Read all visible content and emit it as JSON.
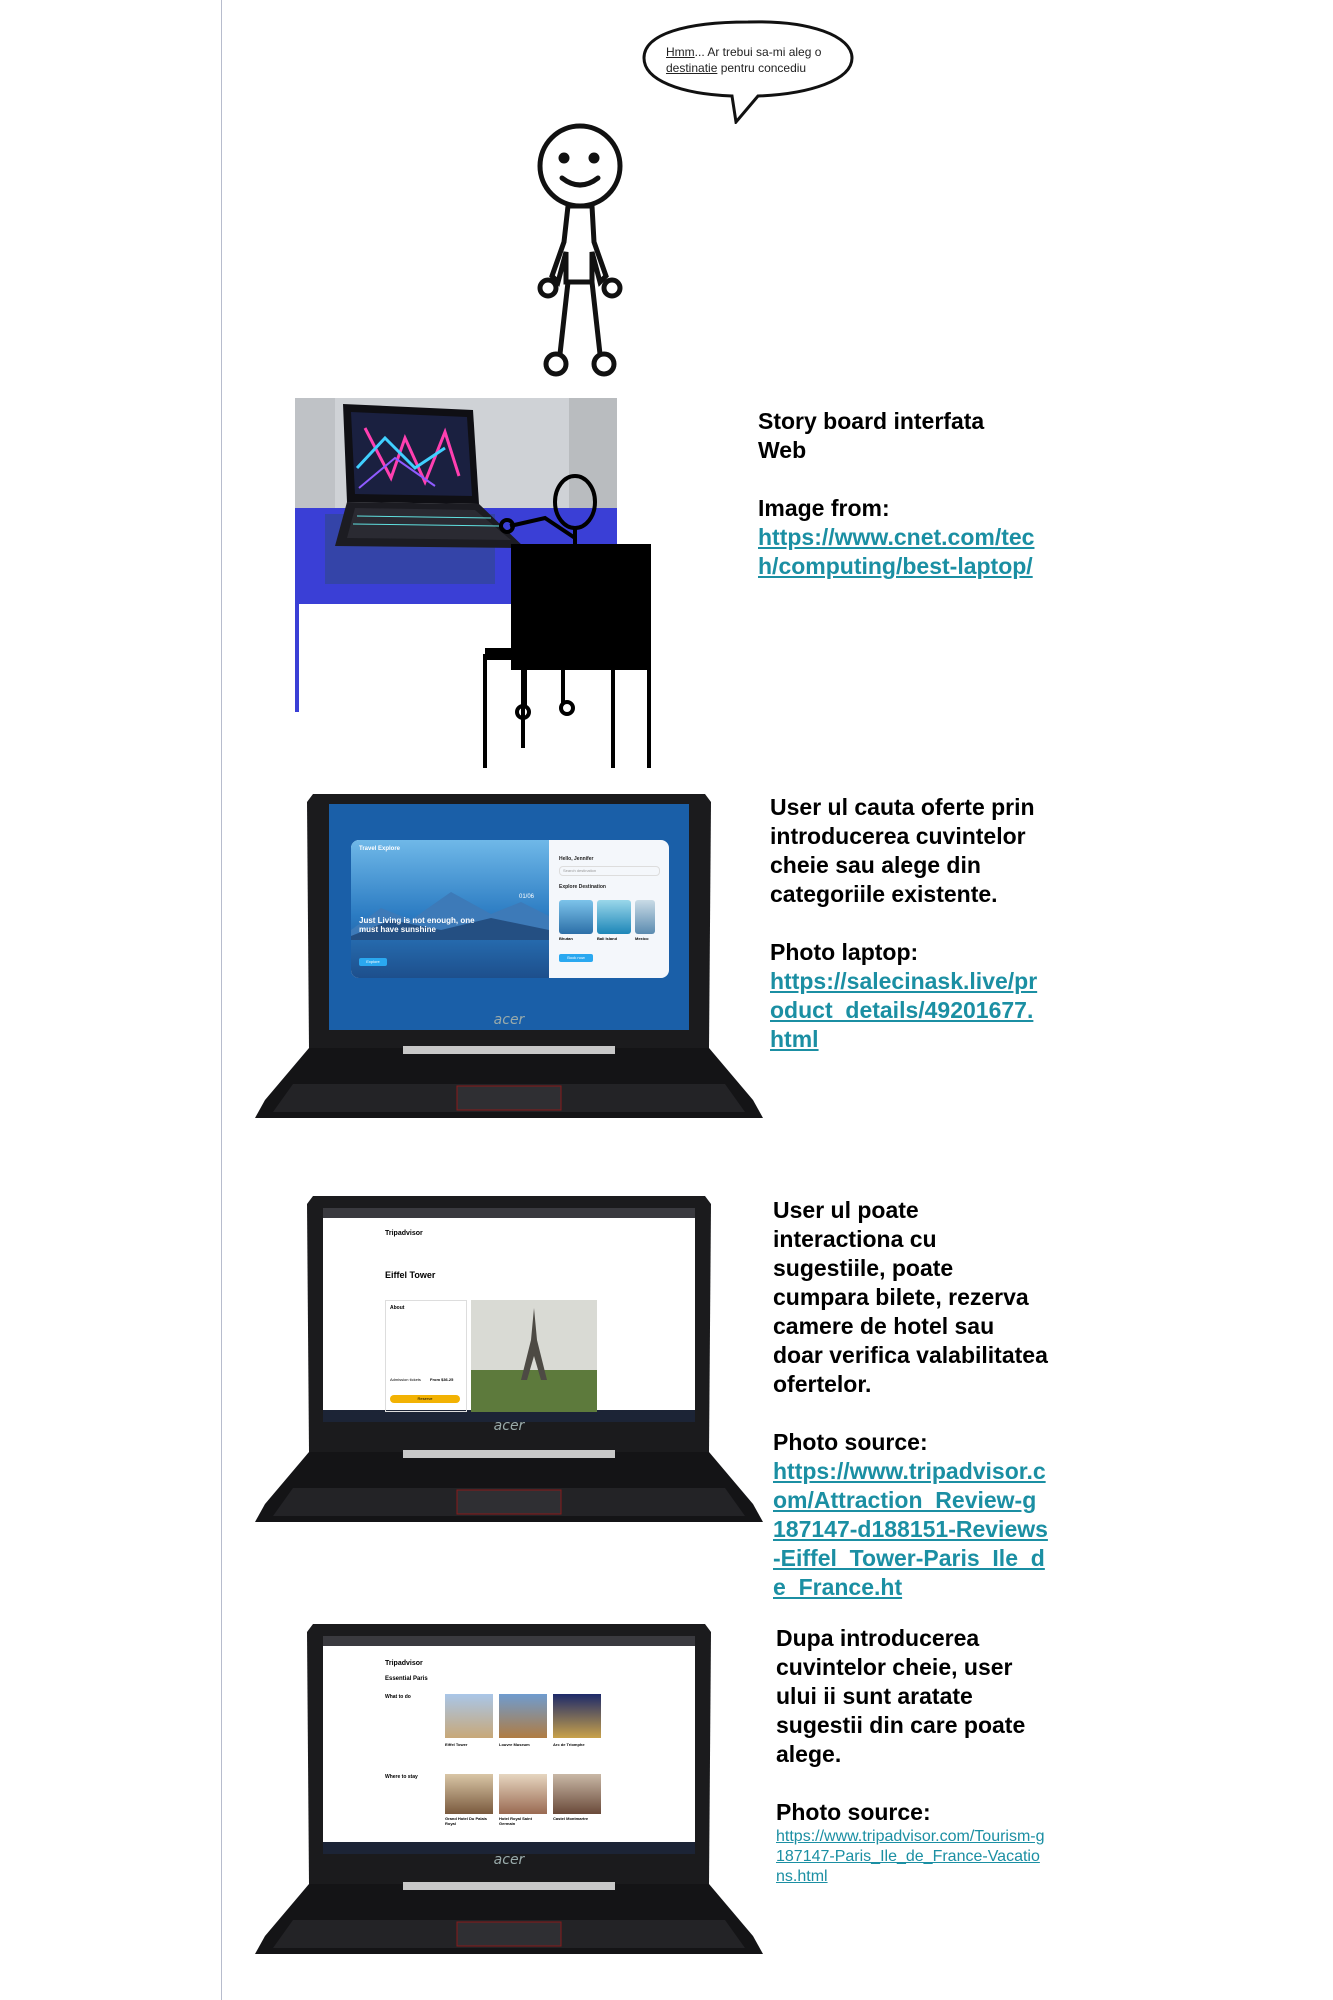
{
  "bubble": {
    "line1_underlined": "Hmm",
    "line1_rest": "... Ar trebui sa-mi aleg o",
    "line2_underlined": "destinatie",
    "line2_rest": " pentru concediu"
  },
  "section1": {
    "title_line1": "Story board interfata",
    "title_line2": "Web",
    "image_label": "Image from:",
    "link": "https://www.cnet.com/tech/computing/best-laptop/"
  },
  "section2": {
    "text": "User ul cauta oferte prin introducerea cuvintelor cheie sau alege din categoriile existente.",
    "photo_label": "Photo laptop:",
    "link": "https://salecinask.live/product_details/49201677.html",
    "screen": {
      "brand": "Travel Explore",
      "headline": "Just Living is not enough, one must have sunshine",
      "greeting": "Hello, Jennifer",
      "search_placeholder": "Search destination",
      "section_title": "Explore Destination",
      "slide_counter": "01/06",
      "cards": [
        "Bhutan",
        "Bali Island",
        "Mexico"
      ],
      "button_left": "Explore",
      "button_right": "Book now"
    }
  },
  "section3": {
    "text": "User ul poate interactiona cu sugestiile, poate cumpara bilete, rezerva camere de hotel sau doar verifica valabilitatea ofertelor.",
    "photo_label": "Photo source:",
    "link": "https://www.tripadvisor.com/Attraction_Review-g187147-d188151-Reviews-Eiffel_Tower-Paris_Ile_de_France.ht",
    "screen": {
      "site": "Tripadvisor",
      "title": "Eiffel Tower",
      "about": "About",
      "price_label": "Admission tickets",
      "price": "From $36.25",
      "reserve": "Reserve"
    }
  },
  "section4": {
    "text": "Dupa introducerea cuvintelor cheie, user ului ii sunt aratate sugestii din care poate alege.",
    "photo_label": "Photo source:",
    "link": "https://www.tripadvisor.com/Tourism-g187147-Paris_Ile_de_France-Vacations.html",
    "screen": {
      "site": "Tripadvisor",
      "title": "Essential Paris",
      "what_to_do": "What to do",
      "where_to_stay": "Where to stay",
      "cards_top": [
        "Eiffel Tower",
        "Louvre Museum",
        "Arc de Triomphe"
      ],
      "cards_bottom": [
        "Grand Hotel Du Palais Royal",
        "Hotel Royal Saint Germain",
        "Castel Montmartre"
      ]
    }
  },
  "laptop_brand": "acer",
  "colors": {
    "link": "#1b8fa3",
    "desk": "#3a3fd6",
    "laptop": "#1b1b1d"
  }
}
